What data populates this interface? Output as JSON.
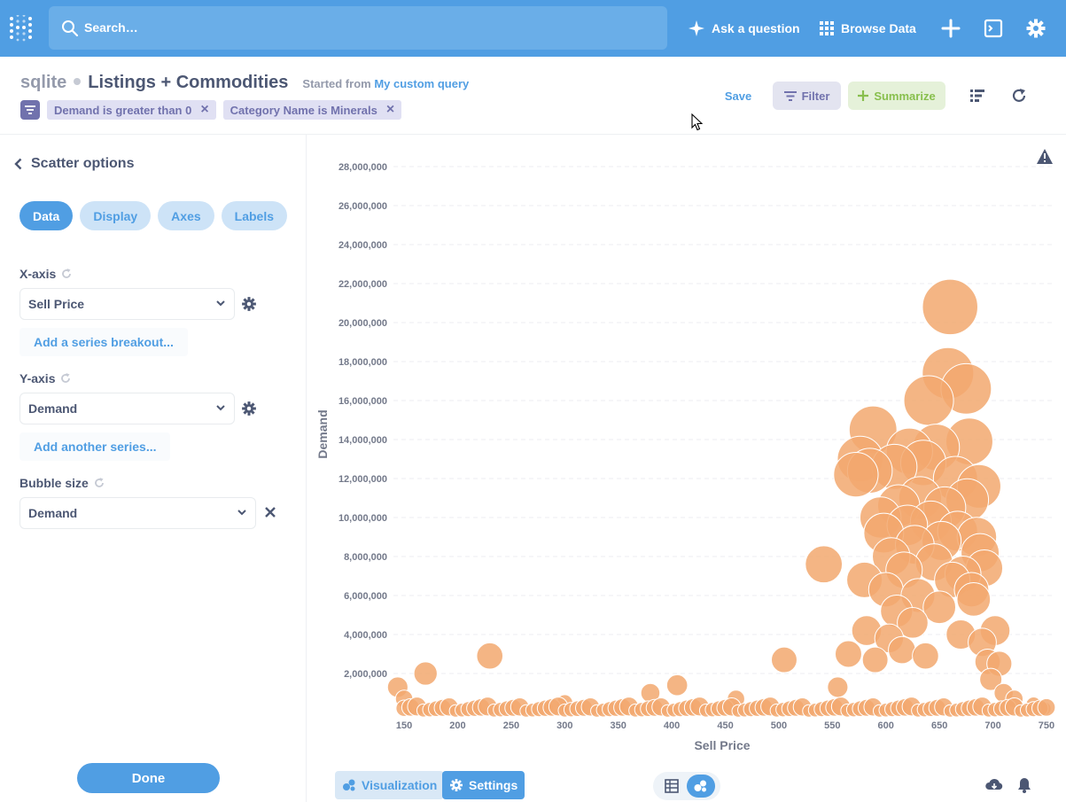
{
  "nav": {
    "search_placeholder": "Search…",
    "ask_question": "Ask a question",
    "browse_data": "Browse Data"
  },
  "header": {
    "database": "sqlite",
    "title": "Listings + Commodities",
    "started_from_prefix": "Started from",
    "started_from_link": "My custom query",
    "filters": [
      "Demand is greater than 0",
      "Category Name is Minerals"
    ],
    "save": "Save",
    "filter": "Filter",
    "summarize": "Summarize"
  },
  "sidebar": {
    "title": "Scatter options",
    "tabs": [
      "Data",
      "Display",
      "Axes",
      "Labels"
    ],
    "x_axis_label": "X-axis",
    "x_axis_value": "Sell Price",
    "add_breakout": "Add a series breakout...",
    "y_axis_label": "Y-axis",
    "y_axis_value": "Demand",
    "add_series": "Add another series...",
    "bubble_label": "Bubble size",
    "bubble_value": "Demand",
    "done": "Done"
  },
  "footer": {
    "visualization": "Visualization",
    "settings": "Settings"
  },
  "colors": {
    "brand": "#509ee3",
    "filter": "#7172ad",
    "summarize": "#88bf4d",
    "bubble": "#f2a86f"
  },
  "chart_data": {
    "type": "scatter",
    "xlabel": "Sell Price",
    "ylabel": "Demand",
    "xlim": [
      140,
      755
    ],
    "ylim": [
      0,
      29000000
    ],
    "xticks": [
      150,
      200,
      250,
      300,
      350,
      400,
      450,
      500,
      550,
      600,
      650,
      700,
      750
    ],
    "yticks": [
      2000000,
      4000000,
      6000000,
      8000000,
      10000000,
      12000000,
      14000000,
      16000000,
      18000000,
      20000000,
      22000000,
      24000000,
      26000000,
      28000000
    ],
    "ytick_labels": [
      "2,000,000",
      "4,000,000",
      "6,000,000",
      "8,000,000",
      "10,000,000",
      "12,000,000",
      "14,000,000",
      "16,000,000",
      "18,000,000",
      "20,000,000",
      "22,000,000",
      "24,000,000",
      "26,000,000",
      "28,000,000"
    ],
    "grid": true,
    "points": [
      [
        144,
        1300000
      ],
      [
        150,
        700000
      ],
      [
        170,
        2000000
      ],
      [
        230,
        2900000
      ],
      [
        300,
        500000
      ],
      [
        380,
        1000000
      ],
      [
        405,
        1400000
      ],
      [
        460,
        700000
      ],
      [
        505,
        2700000
      ],
      [
        542,
        7600000
      ],
      [
        555,
        1300000
      ],
      [
        565,
        3000000
      ],
      [
        572,
        12200000
      ],
      [
        576,
        13000000
      ],
      [
        580,
        6800000
      ],
      [
        582,
        4200000
      ],
      [
        585,
        12400000
      ],
      [
        588,
        14500000
      ],
      [
        590,
        2700000
      ],
      [
        595,
        10000000
      ],
      [
        598,
        9200000
      ],
      [
        600,
        6300000
      ],
      [
        603,
        3800000
      ],
      [
        605,
        8000000
      ],
      [
        608,
        12600000
      ],
      [
        610,
        5200000
      ],
      [
        612,
        10600000
      ],
      [
        615,
        3200000
      ],
      [
        617,
        7300000
      ],
      [
        620,
        9600000
      ],
      [
        622,
        13400000
      ],
      [
        625,
        4600000
      ],
      [
        627,
        8600000
      ],
      [
        630,
        6000000
      ],
      [
        632,
        11000000
      ],
      [
        635,
        12800000
      ],
      [
        637,
        2900000
      ],
      [
        640,
        16000000
      ],
      [
        642,
        9800000
      ],
      [
        645,
        7700000
      ],
      [
        647,
        13600000
      ],
      [
        650,
        5400000
      ],
      [
        652,
        8800000
      ],
      [
        655,
        10500000
      ],
      [
        658,
        17400000
      ],
      [
        660,
        20800000
      ],
      [
        662,
        6800000
      ],
      [
        665,
        12000000
      ],
      [
        667,
        9300000
      ],
      [
        670,
        4000000
      ],
      [
        672,
        7100000
      ],
      [
        675,
        16600000
      ],
      [
        676,
        10900000
      ],
      [
        678,
        13900000
      ],
      [
        680,
        6300000
      ],
      [
        682,
        5800000
      ],
      [
        685,
        9000000
      ],
      [
        687,
        11600000
      ],
      [
        688,
        8200000
      ],
      [
        690,
        3600000
      ],
      [
        692,
        7400000
      ],
      [
        695,
        2600000
      ],
      [
        698,
        1700000
      ],
      [
        702,
        4200000
      ],
      [
        706,
        2500000
      ],
      [
        710,
        1000000
      ],
      [
        720,
        700000
      ],
      [
        738,
        400000
      ],
      [
        748,
        200000
      ]
    ]
  }
}
